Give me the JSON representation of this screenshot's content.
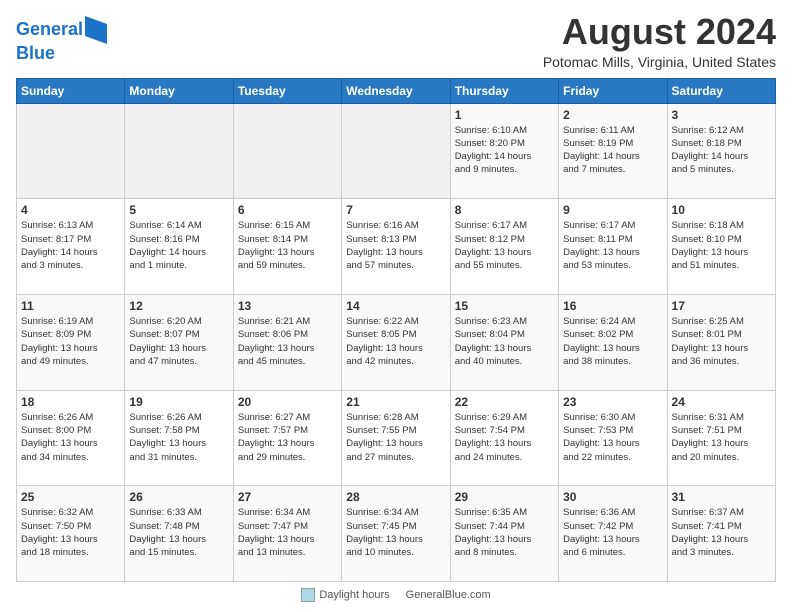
{
  "logo": {
    "line1": "General",
    "line2": "Blue"
  },
  "title": "August 2024",
  "subtitle": "Potomac Mills, Virginia, United States",
  "days_of_week": [
    "Sunday",
    "Monday",
    "Tuesday",
    "Wednesday",
    "Thursday",
    "Friday",
    "Saturday"
  ],
  "weeks": [
    [
      {
        "day": "",
        "info": ""
      },
      {
        "day": "",
        "info": ""
      },
      {
        "day": "",
        "info": ""
      },
      {
        "day": "",
        "info": ""
      },
      {
        "day": "1",
        "info": "Sunrise: 6:10 AM\nSunset: 8:20 PM\nDaylight: 14 hours\nand 9 minutes."
      },
      {
        "day": "2",
        "info": "Sunrise: 6:11 AM\nSunset: 8:19 PM\nDaylight: 14 hours\nand 7 minutes."
      },
      {
        "day": "3",
        "info": "Sunrise: 6:12 AM\nSunset: 8:18 PM\nDaylight: 14 hours\nand 5 minutes."
      }
    ],
    [
      {
        "day": "4",
        "info": "Sunrise: 6:13 AM\nSunset: 8:17 PM\nDaylight: 14 hours\nand 3 minutes."
      },
      {
        "day": "5",
        "info": "Sunrise: 6:14 AM\nSunset: 8:16 PM\nDaylight: 14 hours\nand 1 minute."
      },
      {
        "day": "6",
        "info": "Sunrise: 6:15 AM\nSunset: 8:14 PM\nDaylight: 13 hours\nand 59 minutes."
      },
      {
        "day": "7",
        "info": "Sunrise: 6:16 AM\nSunset: 8:13 PM\nDaylight: 13 hours\nand 57 minutes."
      },
      {
        "day": "8",
        "info": "Sunrise: 6:17 AM\nSunset: 8:12 PM\nDaylight: 13 hours\nand 55 minutes."
      },
      {
        "day": "9",
        "info": "Sunrise: 6:17 AM\nSunset: 8:11 PM\nDaylight: 13 hours\nand 53 minutes."
      },
      {
        "day": "10",
        "info": "Sunrise: 6:18 AM\nSunset: 8:10 PM\nDaylight: 13 hours\nand 51 minutes."
      }
    ],
    [
      {
        "day": "11",
        "info": "Sunrise: 6:19 AM\nSunset: 8:09 PM\nDaylight: 13 hours\nand 49 minutes."
      },
      {
        "day": "12",
        "info": "Sunrise: 6:20 AM\nSunset: 8:07 PM\nDaylight: 13 hours\nand 47 minutes."
      },
      {
        "day": "13",
        "info": "Sunrise: 6:21 AM\nSunset: 8:06 PM\nDaylight: 13 hours\nand 45 minutes."
      },
      {
        "day": "14",
        "info": "Sunrise: 6:22 AM\nSunset: 8:05 PM\nDaylight: 13 hours\nand 42 minutes."
      },
      {
        "day": "15",
        "info": "Sunrise: 6:23 AM\nSunset: 8:04 PM\nDaylight: 13 hours\nand 40 minutes."
      },
      {
        "day": "16",
        "info": "Sunrise: 6:24 AM\nSunset: 8:02 PM\nDaylight: 13 hours\nand 38 minutes."
      },
      {
        "day": "17",
        "info": "Sunrise: 6:25 AM\nSunset: 8:01 PM\nDaylight: 13 hours\nand 36 minutes."
      }
    ],
    [
      {
        "day": "18",
        "info": "Sunrise: 6:26 AM\nSunset: 8:00 PM\nDaylight: 13 hours\nand 34 minutes."
      },
      {
        "day": "19",
        "info": "Sunrise: 6:26 AM\nSunset: 7:58 PM\nDaylight: 13 hours\nand 31 minutes."
      },
      {
        "day": "20",
        "info": "Sunrise: 6:27 AM\nSunset: 7:57 PM\nDaylight: 13 hours\nand 29 minutes."
      },
      {
        "day": "21",
        "info": "Sunrise: 6:28 AM\nSunset: 7:55 PM\nDaylight: 13 hours\nand 27 minutes."
      },
      {
        "day": "22",
        "info": "Sunrise: 6:29 AM\nSunset: 7:54 PM\nDaylight: 13 hours\nand 24 minutes."
      },
      {
        "day": "23",
        "info": "Sunrise: 6:30 AM\nSunset: 7:53 PM\nDaylight: 13 hours\nand 22 minutes."
      },
      {
        "day": "24",
        "info": "Sunrise: 6:31 AM\nSunset: 7:51 PM\nDaylight: 13 hours\nand 20 minutes."
      }
    ],
    [
      {
        "day": "25",
        "info": "Sunrise: 6:32 AM\nSunset: 7:50 PM\nDaylight: 13 hours\nand 18 minutes."
      },
      {
        "day": "26",
        "info": "Sunrise: 6:33 AM\nSunset: 7:48 PM\nDaylight: 13 hours\nand 15 minutes."
      },
      {
        "day": "27",
        "info": "Sunrise: 6:34 AM\nSunset: 7:47 PM\nDaylight: 13 hours\nand 13 minutes."
      },
      {
        "day": "28",
        "info": "Sunrise: 6:34 AM\nSunset: 7:45 PM\nDaylight: 13 hours\nand 10 minutes."
      },
      {
        "day": "29",
        "info": "Sunrise: 6:35 AM\nSunset: 7:44 PM\nDaylight: 13 hours\nand 8 minutes."
      },
      {
        "day": "30",
        "info": "Sunrise: 6:36 AM\nSunset: 7:42 PM\nDaylight: 13 hours\nand 6 minutes."
      },
      {
        "day": "31",
        "info": "Sunrise: 6:37 AM\nSunset: 7:41 PM\nDaylight: 13 hours\nand 3 minutes."
      }
    ]
  ],
  "footer": {
    "legend1_label": "Daylight hours",
    "legend1_color": "#f0f0f0",
    "powered_by": "GeneralBlue.com"
  },
  "colors": {
    "header_bg": "#2979c2",
    "header_text": "#ffffff",
    "accent": "#1a73c7"
  }
}
